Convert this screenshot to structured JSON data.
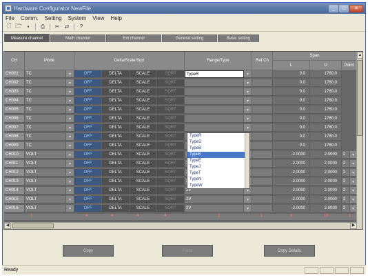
{
  "window": {
    "title": "Hardware Configurator NewFile",
    "minimize": "_",
    "maximize": "□",
    "close": "✕"
  },
  "menu": [
    "File",
    "Comm.",
    "Setting",
    "System",
    "View",
    "Help"
  ],
  "toolbar": [
    "new-icon",
    "open-icon",
    "save-icon",
    "print-icon",
    "cut-icon",
    "comm-icon",
    "help-icon"
  ],
  "tabs": [
    {
      "label": "Measure channel",
      "active": true
    },
    {
      "label": "Math channel",
      "active": false
    },
    {
      "label": "Ext channel",
      "active": false
    },
    {
      "label": "General setting",
      "active": false
    },
    {
      "label": "Basic setting",
      "active": false
    }
  ],
  "grid": {
    "headers": {
      "ch": "CH",
      "mode": "Mode",
      "delta": "Delta/Scale/Sqrt",
      "range": "Range/Type",
      "ref": "Ref.Ch",
      "span": "Span",
      "l": "L",
      "u": "U",
      "point": "Point"
    },
    "rows": [
      {
        "ch": "CH001",
        "mode": "TC",
        "off": "OFF",
        "delta": "DELTA",
        "scale": "SCALE",
        "sqrt": "SQRT",
        "range": "TypeR",
        "l": "0.0",
        "u": "1760.0",
        "point": ""
      },
      {
        "ch": "CH002",
        "mode": "TC",
        "off": "OFF",
        "delta": "DELTA",
        "scale": "SCALE",
        "sqrt": "SQRT",
        "range": "",
        "l": "0.0",
        "u": "1760.0",
        "point": ""
      },
      {
        "ch": "CH003",
        "mode": "TC",
        "off": "OFF",
        "delta": "DELTA",
        "scale": "SCALE",
        "sqrt": "SQRT",
        "range": "",
        "l": "0.0",
        "u": "1760.0",
        "point": ""
      },
      {
        "ch": "CH004",
        "mode": "TC",
        "off": "OFF",
        "delta": "DELTA",
        "scale": "SCALE",
        "sqrt": "SQRT",
        "range": "",
        "l": "0.0",
        "u": "1760.0",
        "point": ""
      },
      {
        "ch": "CH005",
        "mode": "TC",
        "off": "OFF",
        "delta": "DELTA",
        "scale": "SCALE",
        "sqrt": "SQRT",
        "range": "",
        "l": "0.0",
        "u": "1760.0",
        "point": ""
      },
      {
        "ch": "CH006",
        "mode": "TC",
        "off": "OFF",
        "delta": "DELTA",
        "scale": "SCALE",
        "sqrt": "SQRT",
        "range": "",
        "l": "0.0",
        "u": "1760.0",
        "point": ""
      },
      {
        "ch": "CH007",
        "mode": "TC",
        "off": "OFF",
        "delta": "DELTA",
        "scale": "SCALE",
        "sqrt": "SQRT",
        "range": "",
        "l": "0.0",
        "u": "1760.0",
        "point": ""
      },
      {
        "ch": "CH008",
        "mode": "TC",
        "off": "OFF",
        "delta": "DELTA",
        "scale": "SCALE",
        "sqrt": "SQRT",
        "range": "TypeR",
        "l": "0.0",
        "u": "1760.0",
        "point": ""
      },
      {
        "ch": "CH009",
        "mode": "TC",
        "off": "OFF",
        "delta": "DELTA",
        "scale": "SCALE",
        "sqrt": "SQRT",
        "range": "TypeR",
        "l": "0.0",
        "u": "1760.0",
        "point": ""
      },
      {
        "ch": "CH010",
        "mode": "VOLT",
        "off": "OFF",
        "delta": "DELTA",
        "scale": "SCALE",
        "sqrt": "SQRT",
        "range": "2V",
        "l": "-2.0000",
        "u": "2.0000",
        "point": "2"
      },
      {
        "ch": "CH011",
        "mode": "VOLT",
        "off": "OFF",
        "delta": "DELTA",
        "scale": "SCALE",
        "sqrt": "SQRT",
        "range": "2V",
        "l": "-2.0000",
        "u": "2.0000",
        "point": "2"
      },
      {
        "ch": "CH012",
        "mode": "VOLT",
        "off": "OFF",
        "delta": "DELTA",
        "scale": "SCALE",
        "sqrt": "SQRT",
        "range": "2V",
        "l": "-2.0000",
        "u": "2.0000",
        "point": "2"
      },
      {
        "ch": "CH013",
        "mode": "VOLT",
        "off": "OFF",
        "delta": "DELTA",
        "scale": "SCALE",
        "sqrt": "SQRT",
        "range": "2V",
        "l": "-2.0000",
        "u": "2.0000",
        "point": "2"
      },
      {
        "ch": "CH014",
        "mode": "VOLT",
        "off": "OFF",
        "delta": "DELTA",
        "scale": "SCALE",
        "sqrt": "SQRT",
        "range": "2V",
        "l": "-2.0000",
        "u": "2.0000",
        "point": "2"
      },
      {
        "ch": "CH015",
        "mode": "VOLT",
        "off": "OFF",
        "delta": "DELTA",
        "scale": "SCALE",
        "sqrt": "SQRT",
        "range": "2V",
        "l": "-2.0000",
        "u": "2.0000",
        "point": "2"
      },
      {
        "ch": "CH016",
        "mode": "VOLT",
        "off": "OFF",
        "delta": "DELTA",
        "scale": "SCALE",
        "sqrt": "SQRT",
        "range": "2V",
        "l": "-2.0000",
        "u": "2.0000",
        "point": "2"
      }
    ],
    "summary": [
      "1",
      "4",
      "4",
      "4",
      "4",
      "3",
      "1",
      "8",
      "16",
      "1"
    ]
  },
  "range_dropdown": {
    "items": [
      "TypeR",
      "TypeS",
      "TypeB",
      "TypeK",
      "TypeE",
      "TypeJ",
      "TypeT",
      "TypeN",
      "TypeW"
    ],
    "selected": "TypeK"
  },
  "buttons": {
    "copy": "Copy",
    "paste": "Paste",
    "copy_details": "Copy Details"
  },
  "status": {
    "text": "Ready"
  },
  "colors": {
    "grid_bg": "#676767",
    "accent": "#4a78c8",
    "summary": "#ff7a6a"
  }
}
